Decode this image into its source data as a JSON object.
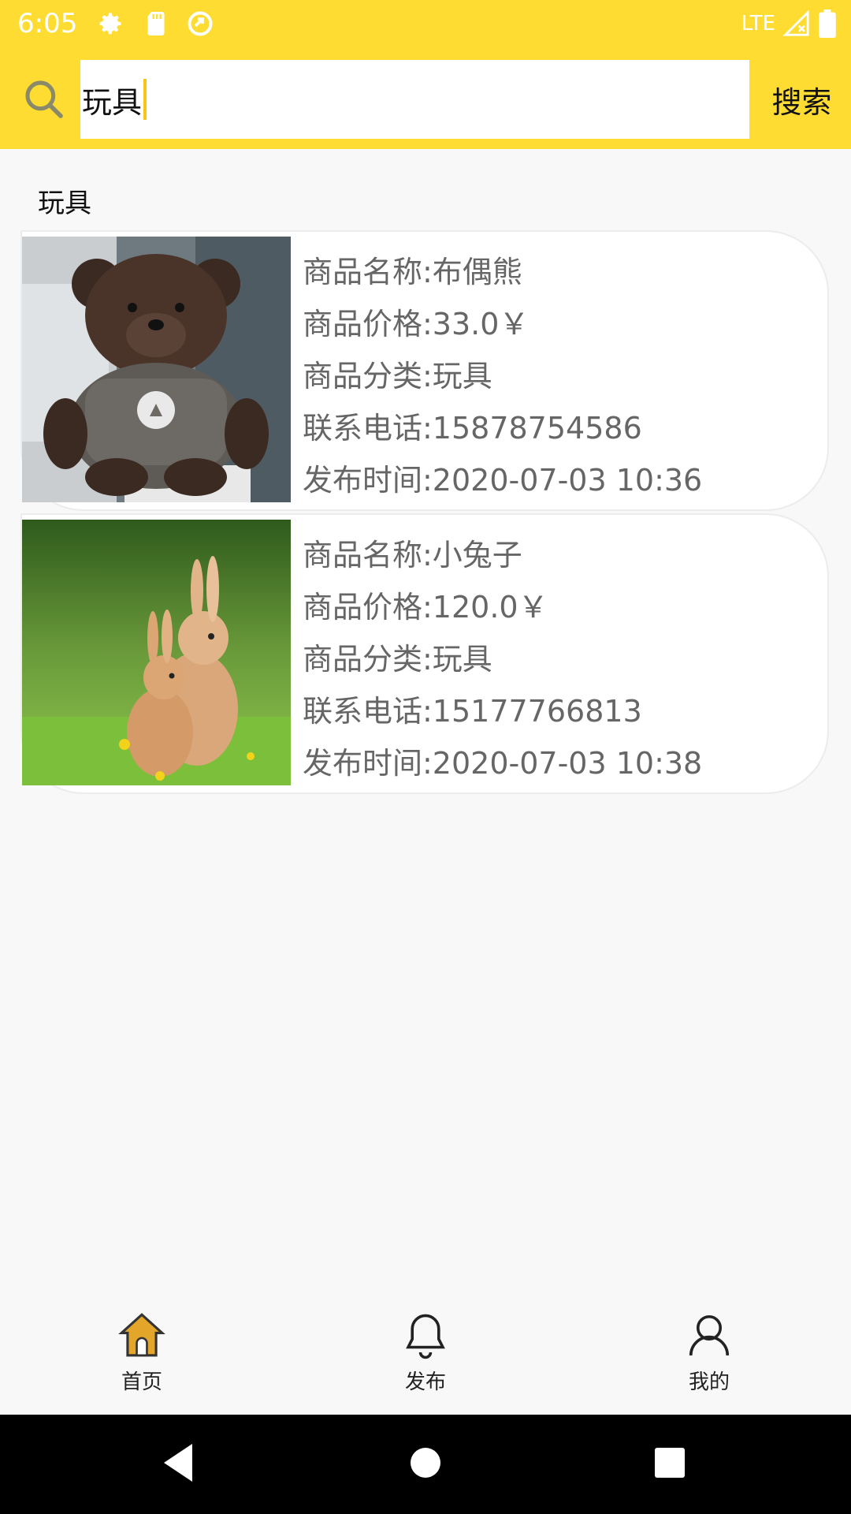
{
  "status_bar": {
    "time": "6:05",
    "network": "LTE",
    "icons": [
      "gear-icon",
      "sd-card-icon",
      "sync-circle-icon",
      "signal-icon",
      "battery-icon"
    ]
  },
  "search": {
    "value": "玩具",
    "button_label": "搜索"
  },
  "category_label": "玩具",
  "products": [
    {
      "name_line": "商品名称:布偶熊",
      "price_line": "商品价格:33.0￥",
      "category_line": "商品分类:玩具",
      "phone_line": "联系电话:15878754586",
      "time_line": "发布时间:2020-07-03 10:36"
    },
    {
      "name_line": "商品名称:小兔子",
      "price_line": "商品价格:120.0￥",
      "category_line": "商品分类:玩具",
      "phone_line": "联系电话:15177766813",
      "time_line": "发布时间:2020-07-03 10:38"
    }
  ],
  "bottom_nav": {
    "items": [
      {
        "label": "首页",
        "icon": "home-icon"
      },
      {
        "label": "发布",
        "icon": "bell-icon"
      },
      {
        "label": "我的",
        "icon": "person-icon"
      }
    ]
  },
  "colors": {
    "accent": "#fedc32",
    "text_secondary": "#666666",
    "home_icon": "#e3a52a"
  }
}
